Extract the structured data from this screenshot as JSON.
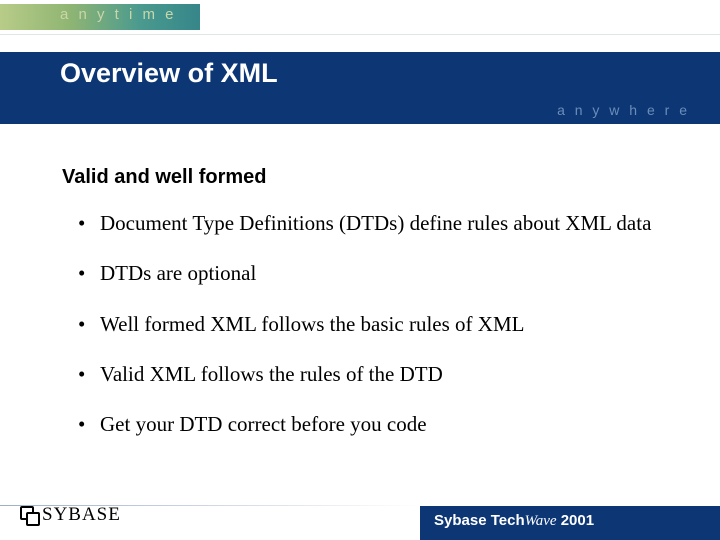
{
  "decoration": {
    "top_word": "a n y t i m e",
    "banner_tag": "a n y w h e r e"
  },
  "slide": {
    "title": "Overview of XML",
    "subtitle": "Valid and well formed",
    "bullets": [
      "Document Type Definitions (DTDs) define rules about XML data",
      "DTDs are optional",
      "Well formed XML follows the basic rules of XML",
      "Valid XML follows the rules of the DTD",
      "Get your DTD correct before you code"
    ]
  },
  "footer": {
    "logo_text": "SYBASE",
    "event_prefix": "Sybase Tech",
    "event_wave": "Wave",
    "event_year": " 2001"
  }
}
